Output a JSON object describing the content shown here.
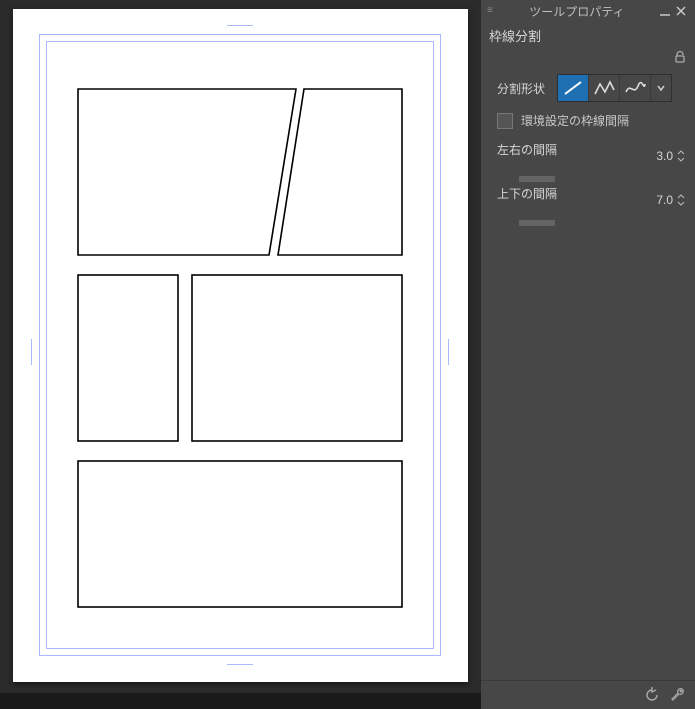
{
  "toolpanel": {
    "title": "ツールプロパティ",
    "subtool": "枠線分割",
    "shape_label": "分割形状",
    "use_pref_gap": "環境設定の枠線間隔",
    "h_gap_label": "左右の間隔",
    "h_gap_value": "3.0",
    "v_gap_label": "上下の間隔",
    "v_gap_value": "7.0"
  }
}
